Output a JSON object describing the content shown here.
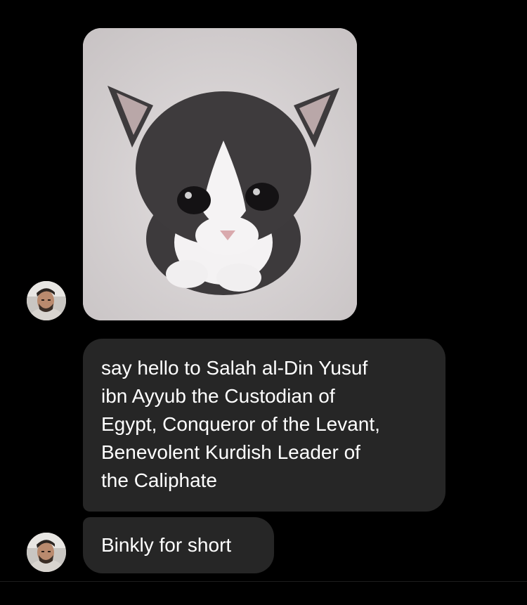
{
  "messages": [
    {
      "type": "image",
      "alt": "kitten photo"
    },
    {
      "type": "text",
      "lines": [
        "say hello to Salah al-Din Yusuf",
        "ibn Ayyub the Custodian of",
        "Egypt, Conqueror of the Levant,",
        "Benevolent Kurdish Leader of",
        "the Caliphate"
      ]
    },
    {
      "type": "text",
      "lines": [
        "Binkly for short"
      ]
    }
  ],
  "colors": {
    "background": "#000000",
    "bubble": "#262626",
    "text": "#ffffff"
  }
}
